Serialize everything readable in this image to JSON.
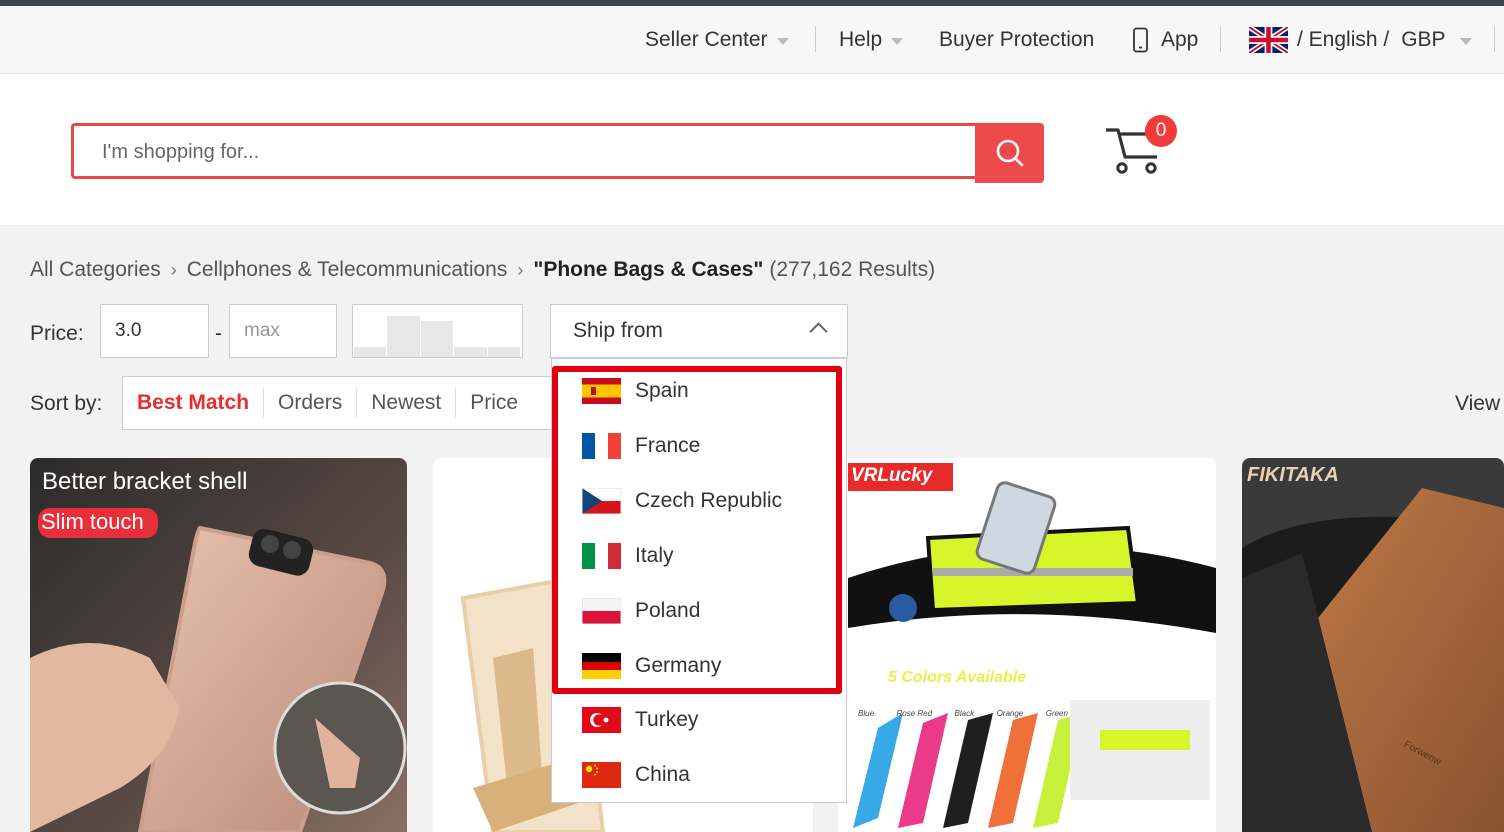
{
  "topbar": {
    "seller_center": "Seller Center",
    "help": "Help",
    "buyer_protection": "Buyer Protection",
    "app": "App",
    "language": "/ English /",
    "currency": "GBP"
  },
  "search": {
    "placeholder": "I'm shopping for..."
  },
  "cart": {
    "count": "0"
  },
  "breadcrumb": {
    "root": "All Categories",
    "category": "Cellphones & Telecommunications",
    "current": "\"Phone Bags & Cases\"",
    "results": "(277,162 Results)"
  },
  "filters": {
    "price_label": "Price:",
    "price_min_value": "3.0",
    "price_max_placeholder": "max",
    "price_dash": "-",
    "price_histogram": [
      0.2,
      0.85,
      0.75,
      0.2,
      0.2
    ],
    "ship_from_label": "Ship from"
  },
  "sort": {
    "label": "Sort by:",
    "options": [
      "Best Match",
      "Orders",
      "Newest",
      "Price"
    ],
    "active": "Best Match"
  },
  "view_label": "View",
  "ship_from_options": [
    "Spain",
    "France",
    "Czech Republic",
    "Italy",
    "Poland",
    "Germany",
    "Turkey",
    "China"
  ],
  "products": {
    "p1_text1": "Better bracket shell",
    "p1_text2": "Slim touch",
    "p3_brand": "VRLucky",
    "p3_caption": "5 Colors Available",
    "p3_colors": [
      "Blue",
      "Rose Red",
      "Black",
      "Orange",
      "Green"
    ],
    "p4_brand": "FIKITAKA",
    "p4_stamp": "Forwenw"
  },
  "colors": {
    "accent_red": "#ee4a4c",
    "highlight_red": "#e2000f"
  }
}
